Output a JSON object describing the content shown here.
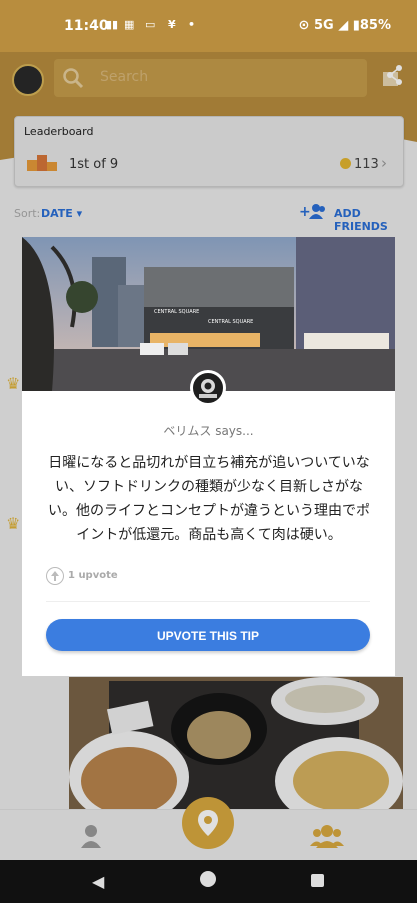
{
  "status": {
    "time": "11:40",
    "network": "5G",
    "battery": "85%"
  },
  "header": {
    "search_placeholder": "Search"
  },
  "leaderboard": {
    "title": "Leaderboard",
    "rank": "1st of 9",
    "score": "113"
  },
  "sort": {
    "label": "Sort:",
    "value": "DATE",
    "add_friends": "ADD FRIENDS"
  },
  "tip": {
    "author_says": "ベリムス says...",
    "text": "日曜になると品切れが目立ち補充が追いついていない、ソフトドリンクの種類が少なく目新しさがない。他のライフとコンセプトが違うという理由でポイントが低還元。商品も高くて肉は硬い。",
    "upvotes": "1 upvote",
    "button": "UPVOTE THIS TIP",
    "photo_signs": [
      "CENTRAL SQUARE",
      "CENTRAL SQUARE"
    ]
  },
  "colors": {
    "brand": "#b88d3e",
    "accent": "#3b7de0",
    "gold": "#d9a93f"
  }
}
